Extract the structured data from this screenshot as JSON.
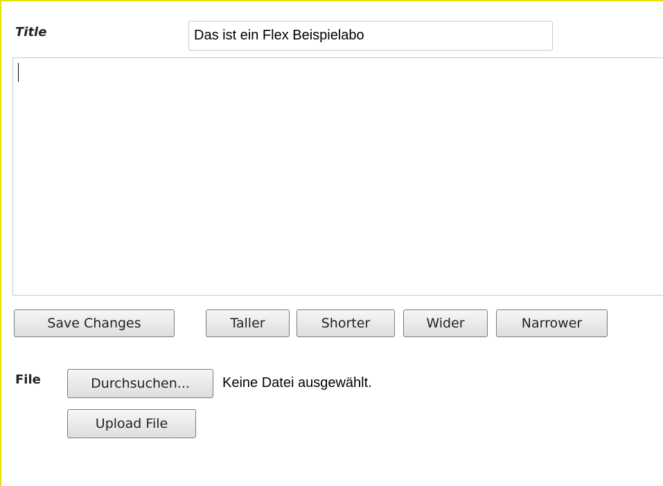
{
  "title_field": {
    "label": "Title",
    "value": "Das ist ein Flex Beispielabo"
  },
  "editor": {
    "content": ""
  },
  "toolbar": {
    "save_label": "Save Changes",
    "taller_label": "Taller",
    "shorter_label": "Shorter",
    "wider_label": "Wider",
    "narrower_label": "Narrower"
  },
  "file_section": {
    "label": "File",
    "browse_label": "Durchsuchen...",
    "status_text": "Keine Datei ausgewählt.",
    "upload_label": "Upload File"
  },
  "colors": {
    "frame_border": "#e8e000",
    "button_border": "#7a7a7a",
    "input_border": "#c8c8c8"
  }
}
